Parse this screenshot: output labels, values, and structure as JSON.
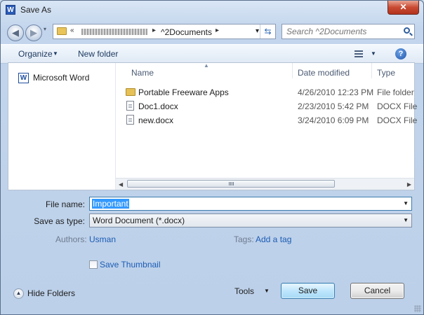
{
  "window": {
    "title": "Save As",
    "app_icon_glyph": "W",
    "close_glyph": "✕"
  },
  "nav": {
    "back_glyph": "◀",
    "forward_glyph": "▶",
    "history_glyph": "▾",
    "address_prefix": "«",
    "address_folder": "^2Documents",
    "address_sep": "▸",
    "address_dropdown": "▾",
    "refresh_glyph": "⇆",
    "search_placeholder": "Search ^2Documents"
  },
  "toolbar": {
    "organize_label": "Organize",
    "organize_arrow": "▼",
    "new_folder_label": "New folder",
    "view_arrow": "▼",
    "help_glyph": "?"
  },
  "nav_pane": {
    "items": [
      {
        "label": "Microsoft Word",
        "icon": "word-icon",
        "glyph": "W"
      }
    ]
  },
  "file_list": {
    "columns": [
      {
        "label": "Name"
      },
      {
        "label": "Date modified"
      },
      {
        "label": "Type"
      }
    ],
    "sort_glyph": "▲",
    "rows": [
      {
        "name": "Portable Freeware Apps",
        "date": "4/26/2010 12:23 PM",
        "type": "File folder",
        "icon": "folder-icon"
      },
      {
        "name": "Doc1.docx",
        "date": "2/23/2010 5:42 PM",
        "type": "DOCX File",
        "icon": "document-icon"
      },
      {
        "name": "new.docx",
        "date": "3/24/2010 6:09 PM",
        "type": "DOCX File",
        "icon": "document-icon"
      }
    ],
    "scroll_left": "◀",
    "scroll_right": "▶"
  },
  "form": {
    "file_name_label": "File name:",
    "file_name_value": "Important",
    "save_type_label": "Save as type:",
    "save_type_value": "Word Document (*.docx)",
    "dropdown_glyph": "▼",
    "authors_label": "Authors:",
    "authors_value": "Usman",
    "tags_label": "Tags:",
    "tags_value": "Add a tag",
    "save_thumbnail_label": "Save Thumbnail",
    "save_thumbnail_checked": false
  },
  "footer": {
    "hide_folders_label": "Hide Folders",
    "hide_folders_glyph": "▲",
    "tools_label": "Tools",
    "tools_arrow": "▼",
    "save_label": "Save",
    "cancel_label": "Cancel"
  }
}
